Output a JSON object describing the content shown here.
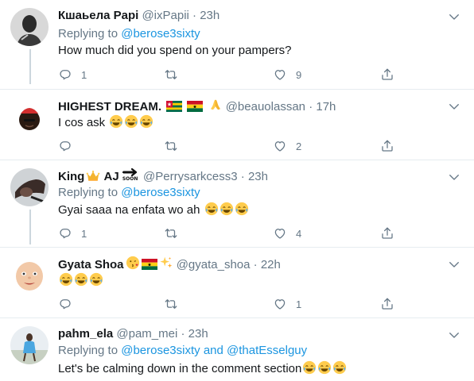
{
  "colors": {
    "link": "#1b95e0",
    "secondary": "#657786",
    "divider": "#e6ecf0",
    "thread": "#ccd6dd"
  },
  "tweets": [
    {
      "name": "Кшаьела Papi",
      "handle": "@ixPapii",
      "time": "23h",
      "replying_prefix": "Replying to",
      "replying_to": "@berose3sixty",
      "text": "How much did you spend on your pampers?",
      "reply_count": "1",
      "retweet_count": "",
      "like_count": "9"
    },
    {
      "name": "HIGHEST DREAM.",
      "name_emojis": [
        "flag-togo",
        "flag-ghana",
        "folded-hands"
      ],
      "handle": "@beauolassan",
      "time": "17h",
      "text": "I cos ask",
      "text_emojis": [
        "joy",
        "joy",
        "joy"
      ],
      "reply_count": "",
      "retweet_count": "",
      "like_count": "2"
    },
    {
      "name": "King",
      "name_emojis": [
        "crown"
      ],
      "name_suffix": "AJ",
      "name_badge": "soon-arrow",
      "name_badge_text": "SOON",
      "handle": "@Perrysarkcess3",
      "time": "23h",
      "replying_prefix": "Replying to",
      "replying_to": "@berose3sixty",
      "text": "Gyai saaa na enfata wo ah",
      "text_emojis": [
        "joy",
        "joy",
        "joy"
      ],
      "reply_count": "1",
      "retweet_count": "",
      "like_count": "4"
    },
    {
      "name": "Gyata Shoa",
      "name_emojis": [
        "kissing-heart",
        "flag-ghana",
        "sparkles"
      ],
      "handle": "@gyata_shoa",
      "time": "22h",
      "text": "",
      "text_emojis": [
        "joy",
        "joy",
        "joy"
      ],
      "reply_count": "",
      "retweet_count": "",
      "like_count": "1"
    },
    {
      "name": "pahm_ela",
      "handle": "@pam_mei",
      "time": "23h",
      "replying_prefix": "Replying to",
      "replying_to": "@berose3sixty",
      "replying_and": "and",
      "replying_to_2": "@thatEsselguy",
      "text": "Let's be calming down in the comment section",
      "text_emojis": [
        "joy",
        "joy",
        "joy"
      ]
    }
  ],
  "icons": {
    "reply": "reply-icon",
    "retweet": "retweet-icon",
    "like": "like-icon",
    "share": "share-icon",
    "more": "chevron-down-icon"
  }
}
